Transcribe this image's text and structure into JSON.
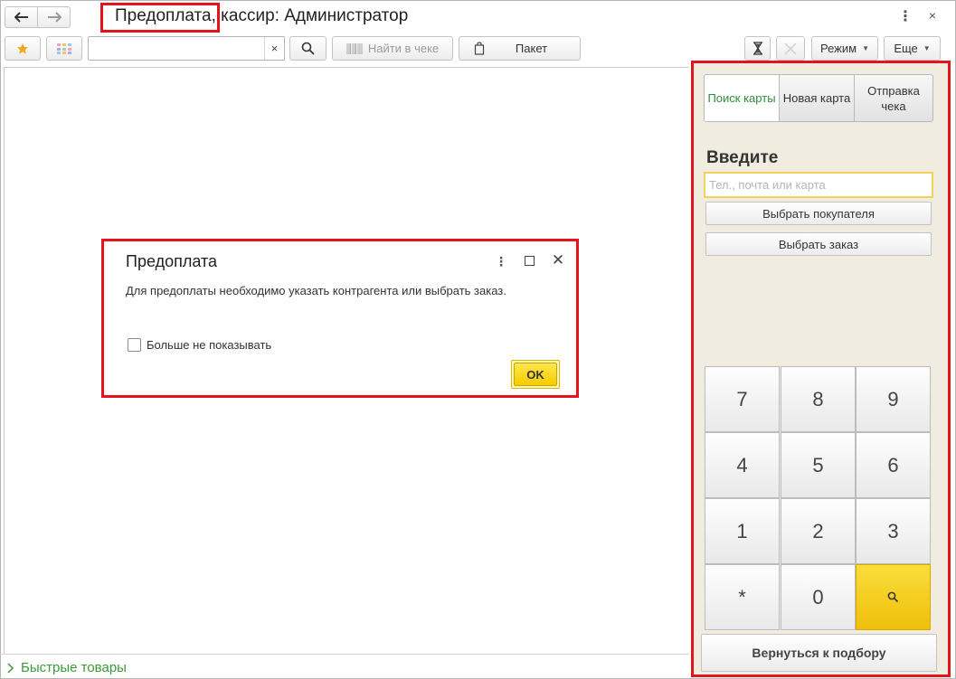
{
  "window": {
    "title": "Предоплата, кассир: Администратор",
    "menu_icon": "⋮",
    "close_icon": "×"
  },
  "nav": {
    "back_icon": "arrow-left-icon",
    "forward_icon": "arrow-right-icon"
  },
  "toolbar": {
    "search_value": "",
    "search_clear": "×",
    "find_in_receipt_label": "Найти в чеке",
    "package_label": "Пакет",
    "mode_label": "Режим",
    "more_label": "Еще"
  },
  "dialog": {
    "title": "Предоплата",
    "message": "Для предоплаты необходимо указать контрагента или выбрать заказ.",
    "checkbox_label": "Больше не показывать",
    "checkbox_checked": false,
    "ok_label": "OK"
  },
  "panel": {
    "tabs": [
      {
        "label": "Поиск карты",
        "active": true
      },
      {
        "label": "Новая карта",
        "active": false
      },
      {
        "label": "Отправка чека",
        "active": false
      }
    ],
    "enter_label": "Введите",
    "input_placeholder": "Тел., почта или карта",
    "input_value": "",
    "select_customer_label": "Выбрать покупателя",
    "select_order_label": "Выбрать заказ",
    "keys": [
      "7",
      "8",
      "9",
      "4",
      "5",
      "6",
      "1",
      "2",
      "3",
      "*",
      "0",
      "search"
    ],
    "back_label": "Вернуться к подбору"
  },
  "footer": {
    "quick_goods_label": "Быстрые товары"
  },
  "colors": {
    "accent_red": "#e3141b",
    "accent_green": "#3a9b37",
    "accent_yellow": "#f5cc00",
    "panel_bg": "#f0ece0"
  }
}
